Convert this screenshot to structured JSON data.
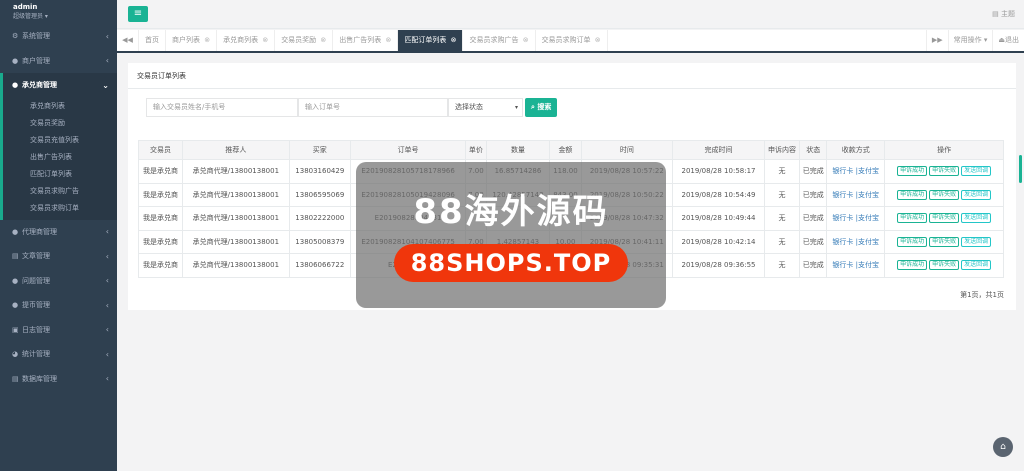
{
  "profile": {
    "name": "admin",
    "role": "超级管理员"
  },
  "menu": {
    "items": [
      {
        "label": "系统管理",
        "icon": "gear-icon",
        "glyph": "⚙"
      },
      {
        "label": "商户管理",
        "icon": "user-icon",
        "glyph": "●"
      }
    ],
    "active": {
      "label": "承兑商管理",
      "icon": "user-icon",
      "glyph": "●"
    },
    "sub": [
      "承兑商列表",
      "交易员奖励",
      "交易员充值列表",
      "出售广告列表",
      "匹配订单列表",
      "交易员求购广告",
      "交易员求购订单"
    ],
    "rest": [
      {
        "label": "代理商管理",
        "icon": "user-icon",
        "glyph": "●"
      },
      {
        "label": "文章管理",
        "icon": "document-icon",
        "glyph": "▤"
      },
      {
        "label": "问题管理",
        "icon": "chat-icon",
        "glyph": "●"
      },
      {
        "label": "提币管理",
        "icon": "user-icon",
        "glyph": "●"
      },
      {
        "label": "日志管理",
        "icon": "log-icon",
        "glyph": "▣"
      },
      {
        "label": "统计管理",
        "icon": "chart-icon",
        "glyph": "◕"
      },
      {
        "label": "数据库管理",
        "icon": "database-icon",
        "glyph": "▤"
      }
    ]
  },
  "header": {
    "toggle": "≡",
    "theme": "主题"
  },
  "tabs": {
    "prev": "◀◀",
    "next": "▶▶",
    "items": [
      "首页",
      "商户列表",
      "承兑商列表",
      "交易员奖励",
      "出售广告列表",
      "匹配订单列表",
      "交易员求购广告",
      "交易员求购订单"
    ],
    "active_index": 5,
    "ops": "常用操作",
    "logout": "退出"
  },
  "panel": {
    "title": "交易员订单列表",
    "search": {
      "name_placeholder": "输入交易员姓名/手机号",
      "order_placeholder": "输入订单号",
      "status": "选择状态",
      "button": "搜索"
    },
    "columns": [
      "交易员",
      "推荐人",
      "买家",
      "订单号",
      "单价",
      "数量",
      "金额",
      "时间",
      "完成时间",
      "申诉内容",
      "状态",
      "收款方式",
      "操作"
    ],
    "rows": [
      [
        "我是承兑商",
        "承兑商代理/13800138001",
        "13803160429",
        "E20190828105718178966",
        "7.00",
        "16.85714286",
        "118.00",
        "2019/08/28 10:57:22",
        "2019/08/28 10:58:17",
        "无",
        "已完成"
      ],
      [
        "我是承兑商",
        "承兑商代理/13800138001",
        "13806595069",
        "E20190828105019428096",
        "7.00",
        "120.42857143",
        "843.00",
        "2019/08/28 10:50:22",
        "2019/08/28 10:54:49",
        "无",
        "已完成"
      ],
      [
        "我是承兑商",
        "承兑商代理/13800138001",
        "13802222000",
        "E20190828104731",
        "",
        "",
        "",
        "2019/08/28 10:47:32",
        "2019/08/28 10:49:44",
        "无",
        "已完成"
      ],
      [
        "我是承兑商",
        "承兑商代理/13800138001",
        "13805008379",
        "E20190828104107406775",
        "7.00",
        "1.42857143",
        "10.00",
        "2019/08/28 10:41:11",
        "2019/08/28 10:42:14",
        "无",
        "已完成"
      ],
      [
        "我是承兑商",
        "承兑商代理/13800138001",
        "13806066722",
        "E20190828",
        "",
        "",
        "",
        "2019/08/28 09:35:31",
        "2019/08/28 09:36:55",
        "无",
        "已完成"
      ]
    ],
    "pay_methods": "银行卡 |支付宝",
    "actions": [
      "申诉成功",
      "申诉失败",
      "发送回调"
    ],
    "pager": "第1页，共1页"
  },
  "watermark": {
    "title": "88海外源码",
    "url": "88SHOPS.TOP"
  },
  "colors": {
    "accent": "#1ab394",
    "sidebar": "#2f4050",
    "watermark": "#f0360c"
  }
}
